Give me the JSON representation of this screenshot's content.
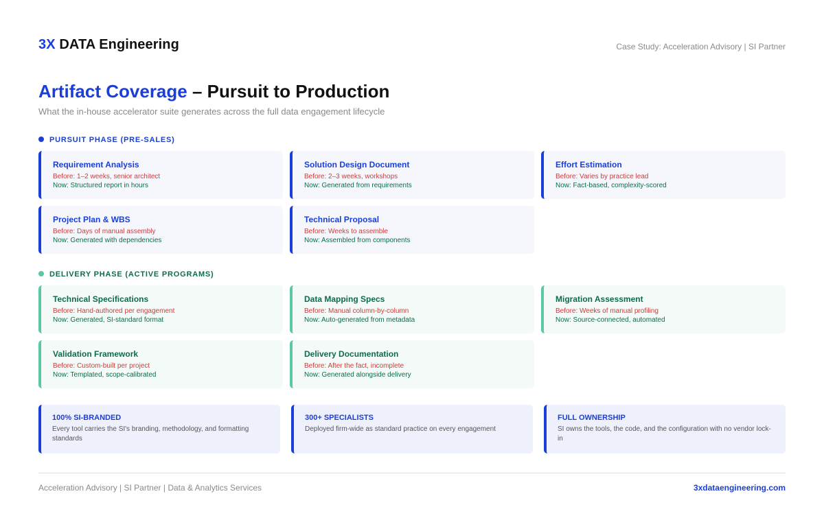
{
  "header": {
    "logo_accent": "3X",
    "logo_text": "DATA Engineering",
    "right_text": "Case Study: Acceleration Advisory | SI Partner"
  },
  "title": {
    "accent": "Artifact Coverage",
    "rest": " – Pursuit to Production",
    "subtitle": "What the in-house accelerator suite generates across the full data engagement lifecycle"
  },
  "pursuit": {
    "label": "PURSUIT PHASE (PRE-SALES)",
    "cards": [
      {
        "title": "Requirement Analysis",
        "before": "Before: 1–2 weeks, senior architect",
        "now": "Now: Structured report in hours"
      },
      {
        "title": "Solution Design Document",
        "before": "Before: 2–3 weeks, workshops",
        "now": "Now: Generated from requirements"
      },
      {
        "title": "Effort Estimation",
        "before": "Before: Varies by practice lead",
        "now": "Now: Fact-based, complexity-scored"
      },
      {
        "title": "Project Plan & WBS",
        "before": "Before: Days of manual assembly",
        "now": "Now: Generated with dependencies"
      },
      {
        "title": "Technical Proposal",
        "before": "Before: Weeks to assemble",
        "now": "Now: Assembled from components"
      }
    ]
  },
  "delivery": {
    "label": "DELIVERY PHASE (ACTIVE PROGRAMS)",
    "cards": [
      {
        "title": "Technical Specifications",
        "before": "Before: Hand-authored per engagement",
        "now": "Now: Generated, SI-standard format"
      },
      {
        "title": "Data Mapping Specs",
        "before": "Before: Manual column-by-column",
        "now": "Now: Auto-generated from metadata"
      },
      {
        "title": "Migration Assessment",
        "before": "Before: Weeks of manual profiling",
        "now": "Now: Source-connected, automated"
      },
      {
        "title": "Validation Framework",
        "before": "Before: Custom-built per project",
        "now": "Now: Templated, scope-calibrated"
      },
      {
        "title": "Delivery Documentation",
        "before": "Before: After the fact, incomplete",
        "now": "Now: Generated alongside delivery"
      }
    ]
  },
  "stats": [
    {
      "title": "100% SI-BRANDED",
      "desc": "Every tool carries the SI's branding, methodology, and formatting standards"
    },
    {
      "title": "300+ SPECIALISTS",
      "desc": "Deployed firm-wide as standard practice on every engagement"
    },
    {
      "title": "FULL OWNERSHIP",
      "desc": "SI owns the tools, the code, and the configuration with no vendor lock-in"
    }
  ],
  "footer": {
    "left": "Acceleration Advisory | SI Partner | Data & Analytics Services",
    "right": "3xdataengineering.com"
  },
  "colors": {
    "accent_blue": "#1a3ed6",
    "delivery_green": "#0f6b48",
    "delivery_dot": "#5cc9a0",
    "before_red": "#d13a3a"
  }
}
